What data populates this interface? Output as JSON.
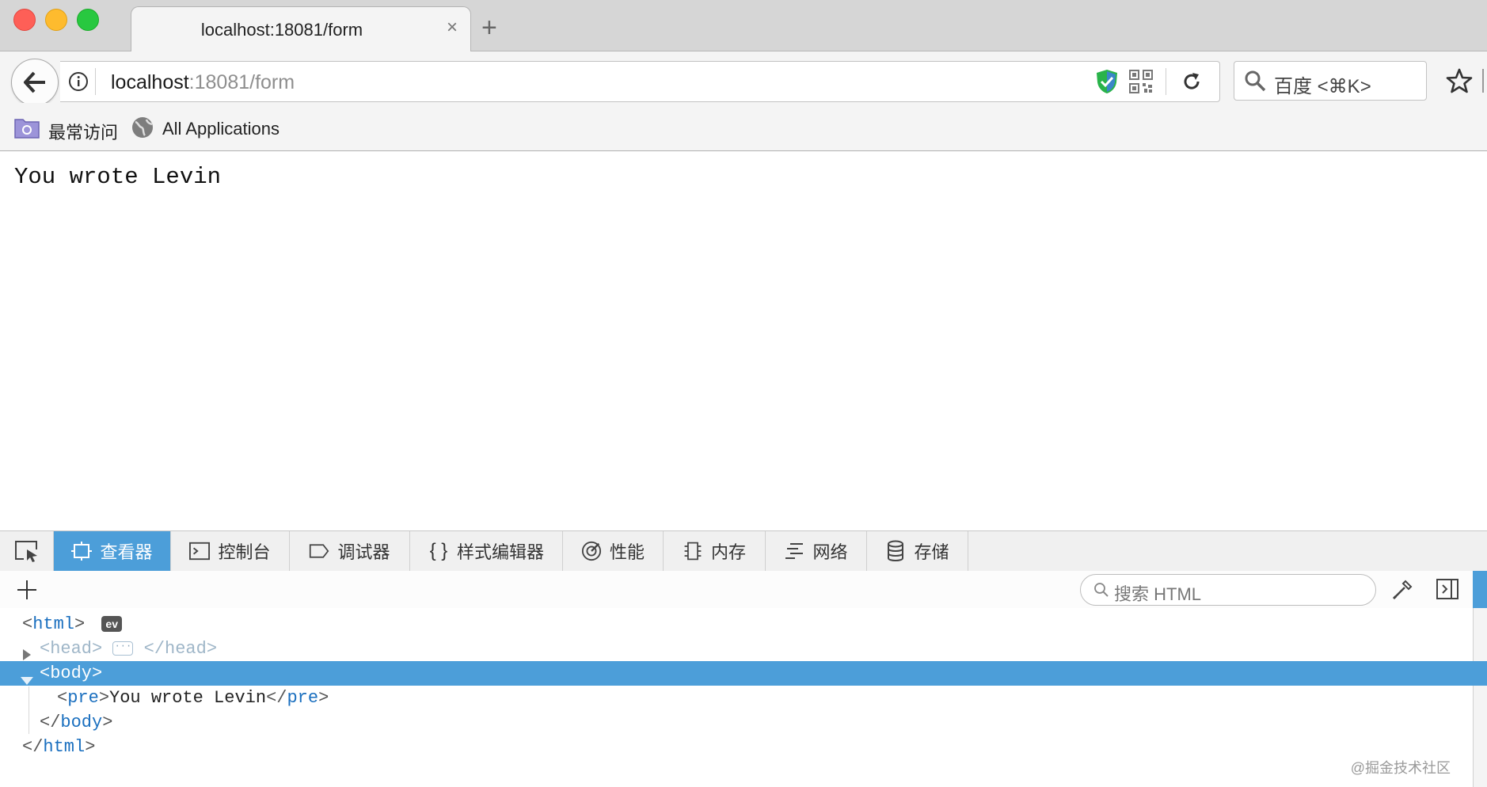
{
  "window": {
    "traffic_lights": {
      "close": "#fe5f57",
      "minimize": "#febb2e",
      "zoom": "#28c840"
    }
  },
  "tab": {
    "title": "localhost:18081/form",
    "close_glyph": "×",
    "new_tab_glyph": "+"
  },
  "navbar": {
    "url_host": "localhost",
    "url_path": ":18081/form",
    "search_placeholder": "百度 <⌘K>",
    "icons": [
      "back-arrow-icon",
      "info-icon",
      "shield-check-icon",
      "qr-code-icon",
      "reload-icon",
      "search-icon",
      "star-icon"
    ]
  },
  "bookmarks": {
    "items": [
      {
        "label": "最常访问",
        "icon": "folder-icon"
      },
      {
        "label": "All Applications",
        "icon": "globe-icon"
      }
    ]
  },
  "page": {
    "pre_text": "You wrote Levin"
  },
  "devtools": {
    "tabs": [
      {
        "label": "查看器",
        "icon": "inspector-icon",
        "active": true
      },
      {
        "label": "控制台",
        "icon": "console-icon",
        "active": false
      },
      {
        "label": "调试器",
        "icon": "debugger-icon",
        "active": false
      },
      {
        "label": "样式编辑器",
        "icon": "braces-icon",
        "active": false
      },
      {
        "label": "性能",
        "icon": "performance-icon",
        "active": false
      },
      {
        "label": "内存",
        "icon": "memory-icon",
        "active": false
      },
      {
        "label": "网络",
        "icon": "network-icon",
        "active": false
      },
      {
        "label": "存储",
        "icon": "storage-icon",
        "active": false
      }
    ],
    "search_placeholder": "搜索 HTML",
    "accent_color": "#4c9ed9"
  },
  "markup": {
    "html_open": "html",
    "ev_badge": "ev",
    "head_tag": "head",
    "head_ellipsis": "···",
    "body_tag": "body",
    "pre_tag": "pre",
    "pre_content": "You wrote Levin",
    "lt": "<",
    "gt": ">",
    "lt_slash": "</"
  },
  "watermark": "@掘金技术社区"
}
